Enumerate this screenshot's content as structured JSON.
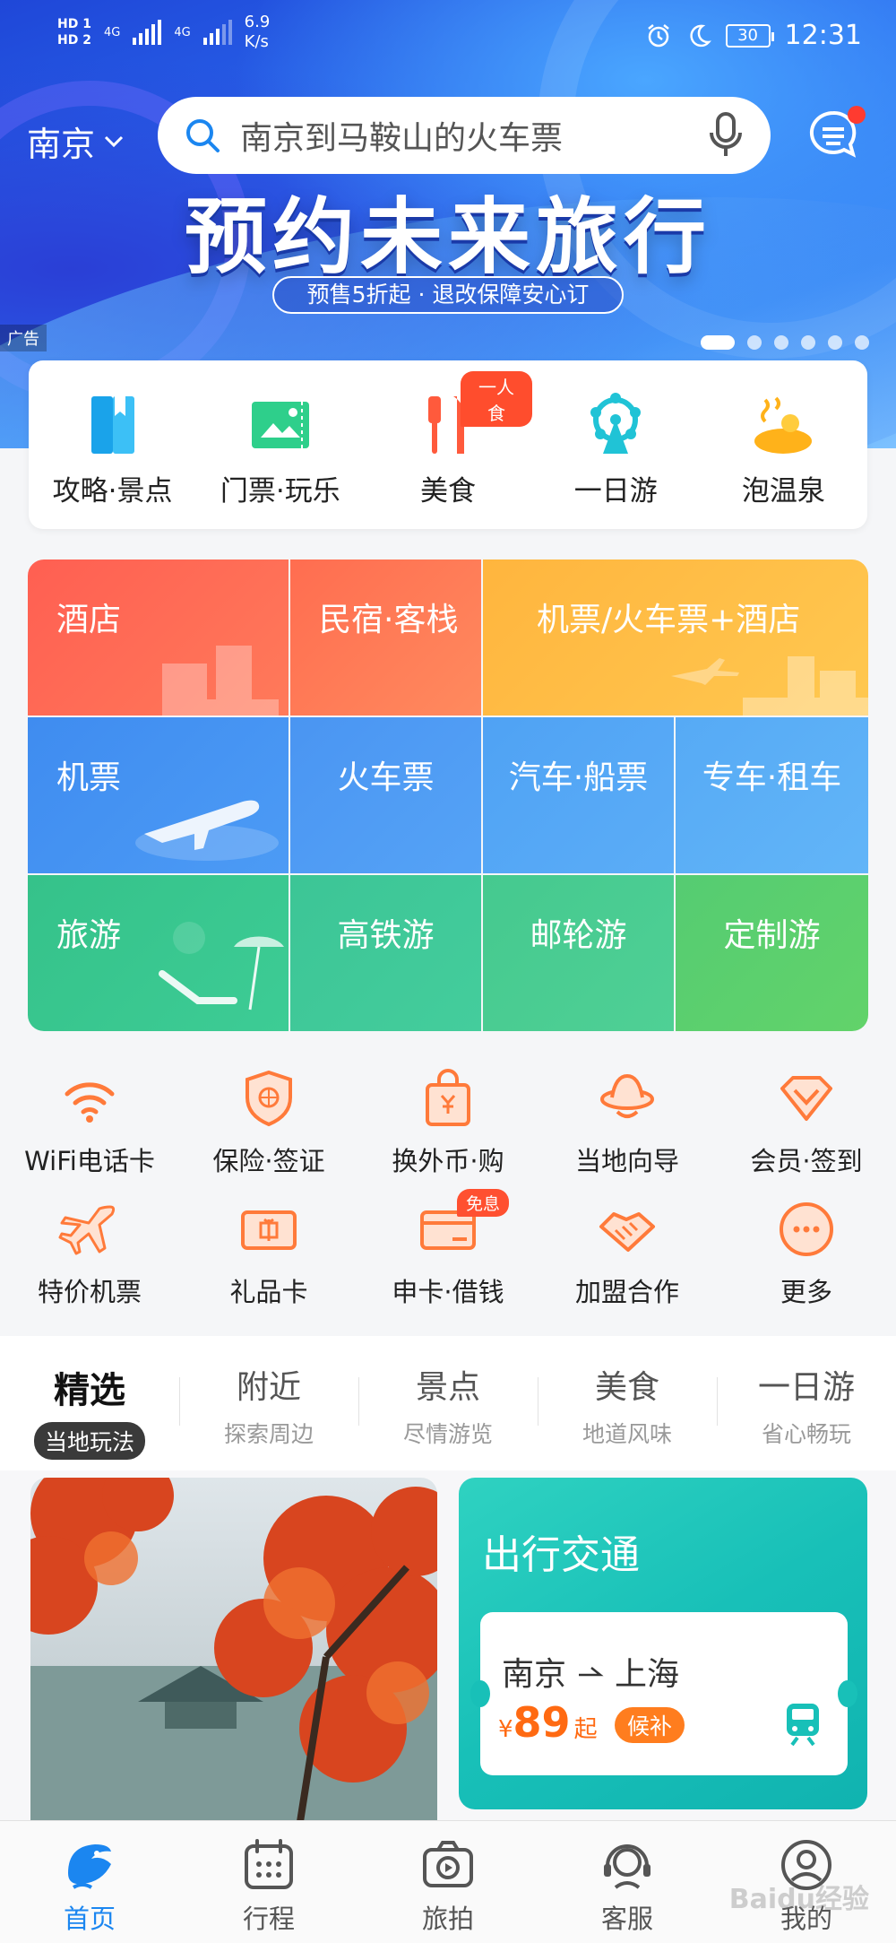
{
  "status_bar": {
    "hd1": "HD 1",
    "hd2": "HD 2",
    "net1": "4G",
    "net2": "4G",
    "speed_value": "6.9",
    "speed_unit": "K/s",
    "battery": "30",
    "time": "12:31"
  },
  "header": {
    "city": "南京",
    "search_placeholder": "南京到马鞍山的火车票"
  },
  "banner": {
    "headline": "预约未来旅行",
    "subline": "预售5折起 · 退改保障安心订",
    "ad_label": "广告",
    "page_count": 6,
    "active_page": 1
  },
  "quick_categories": [
    {
      "label": "攻略·景点",
      "icon": "guide-book-icon"
    },
    {
      "label": "门票·玩乐",
      "icon": "ticket-icon"
    },
    {
      "label": "美食",
      "icon": "fork-knife-icon",
      "badge": "一人食"
    },
    {
      "label": "一日游",
      "icon": "ferris-wheel-icon"
    },
    {
      "label": "泡温泉",
      "icon": "hot-spring-icon"
    }
  ],
  "grid": {
    "hotel": "酒店",
    "homestay": "民宿·客栈",
    "flight_hotel": "机票/火车票+酒店",
    "flight": "机票",
    "train": "火车票",
    "bus_ship": "汽车·船票",
    "car_rental": "专车·租车",
    "travel": "旅游",
    "rail_tour": "高铁游",
    "cruise": "邮轮游",
    "custom": "定制游"
  },
  "services": [
    {
      "label": "WiFi电话卡",
      "icon": "wifi-icon"
    },
    {
      "label": "保险·签证",
      "icon": "shield-icon"
    },
    {
      "label": "换外币·购",
      "icon": "shopping-bag-icon"
    },
    {
      "label": "当地向导",
      "icon": "guide-hat-icon"
    },
    {
      "label": "会员·签到",
      "icon": "diamond-icon"
    },
    {
      "label": "特价机票",
      "icon": "plane-icon"
    },
    {
      "label": "礼品卡",
      "icon": "gift-card-icon"
    },
    {
      "label": "申卡·借钱",
      "icon": "credit-card-icon",
      "badge": "免息"
    },
    {
      "label": "加盟合作",
      "icon": "handshake-icon"
    },
    {
      "label": "更多",
      "icon": "more-icon"
    }
  ],
  "feed_tabs": [
    {
      "title": "精选",
      "sub": "当地玩法",
      "active": true
    },
    {
      "title": "附近",
      "sub": "探索周边"
    },
    {
      "title": "景点",
      "sub": "尽情游览"
    },
    {
      "title": "美食",
      "sub": "地道风味"
    },
    {
      "title": "一日游",
      "sub": "省心畅玩"
    }
  ],
  "transport_card": {
    "title": "出行交通",
    "from": "南京",
    "to": "上海",
    "currency": "¥",
    "price": "89",
    "price_suffix": "起",
    "tag": "候补"
  },
  "bottom_nav": [
    {
      "label": "首页",
      "icon": "dolphin-home-icon",
      "active": true
    },
    {
      "label": "行程",
      "icon": "calendar-icon"
    },
    {
      "label": "旅拍",
      "icon": "camera-icon"
    },
    {
      "label": "客服",
      "icon": "headset-icon"
    },
    {
      "label": "我的",
      "icon": "user-icon"
    }
  ],
  "watermark": "Baidu经验",
  "colors": {
    "brand_blue": "#1b86f0",
    "hotel_red": "#ff5a4e",
    "orange_icon": "#ff7a3a",
    "teal_card": "#18c0b8",
    "price_orange": "#ff6a12"
  }
}
